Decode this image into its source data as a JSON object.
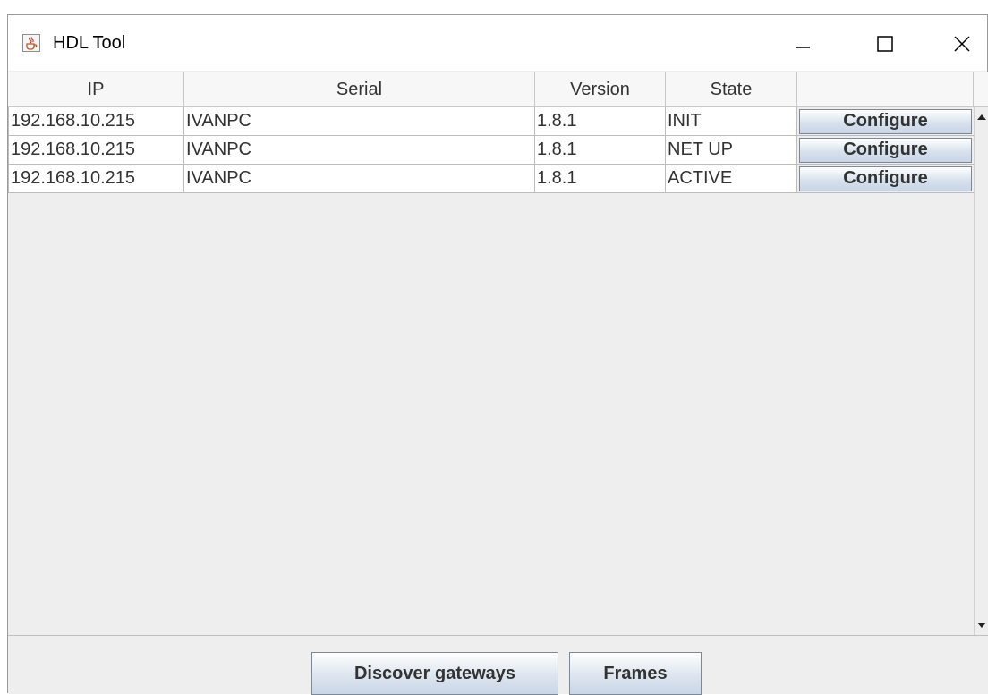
{
  "window": {
    "title": "HDL Tool",
    "icon": "java-cup-icon"
  },
  "table": {
    "columns": [
      "IP",
      "Serial",
      "Version",
      "State",
      ""
    ],
    "rows": [
      {
        "ip": "192.168.10.215",
        "serial": "IVANPC",
        "version": "1.8.1",
        "state": "INIT",
        "action": "Configure"
      },
      {
        "ip": "192.168.10.215",
        "serial": "IVANPC",
        "version": "1.8.1",
        "state": "NET UP",
        "action": "Configure"
      },
      {
        "ip": "192.168.10.215",
        "serial": "IVANPC",
        "version": "1.8.1",
        "state": "ACTIVE",
        "action": "Configure"
      }
    ]
  },
  "buttons": {
    "discover": "Discover gateways",
    "frames": "Frames"
  },
  "colors": {
    "panel": "#eeeeee",
    "button_top": "#ffffff",
    "button_bottom": "#c9d6e6"
  }
}
